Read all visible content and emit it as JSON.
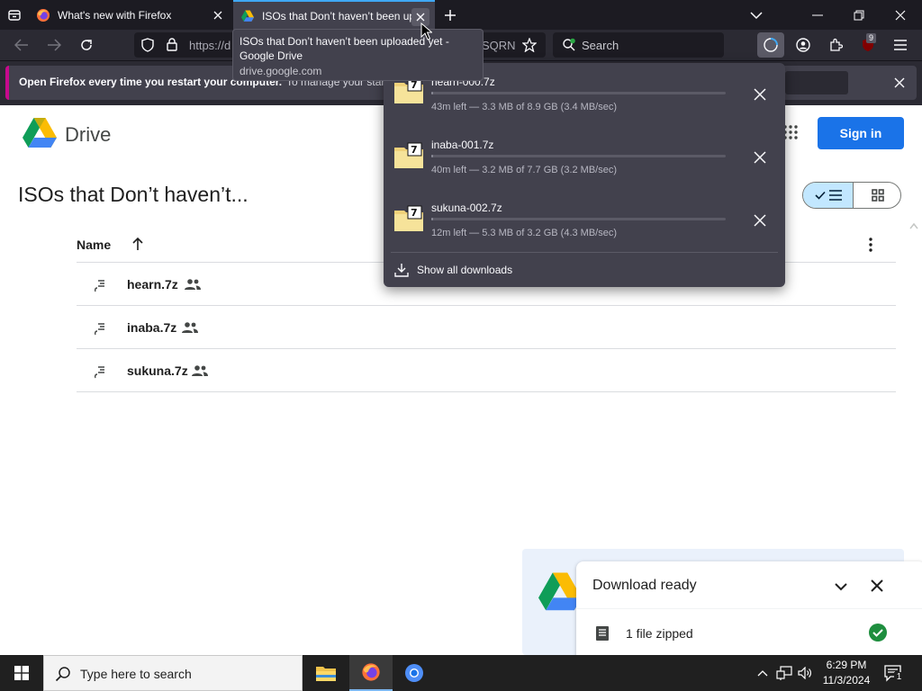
{
  "browser": {
    "tabs": [
      {
        "title": "What's new with Firefox",
        "active": false
      },
      {
        "title": "ISOs that Don’t haven’t been uploaded yet - Google Drive",
        "active": true
      }
    ],
    "url_left": "https://d",
    "url_right": "SQRN",
    "search_placeholder": "Search",
    "extension_badge": "9",
    "tooltip": {
      "title": "ISOs that Don’t haven’t been uploaded yet - Google Drive",
      "domain": "drive.google.com"
    }
  },
  "notification": {
    "bold_text": "Open Firefox every time you restart your computer.",
    "rest_text": "To manage your start"
  },
  "downloads": {
    "items": [
      {
        "name": "hearn-000.7z",
        "status": "43m left — 3.3 MB of 8.9 GB (3.4 MB/sec)",
        "progress": 0.0004
      },
      {
        "name": "inaba-001.7z",
        "status": "40m left — 3.2 MB of 7.7 GB (3.2 MB/sec)",
        "progress": 0.0004
      },
      {
        "name": "sukuna-002.7z",
        "status": "12m left — 5.3 MB of 3.2 GB (4.3 MB/sec)",
        "progress": 0.0017
      }
    ],
    "show_all": "Show all downloads"
  },
  "drive": {
    "brand": "Drive",
    "sign_in": "Sign in",
    "folder_title": "ISOs that Don’t haven’t...",
    "column_name": "Name",
    "files": [
      {
        "name": "hearn.7z",
        "shared": true
      },
      {
        "name": "inaba.7z",
        "shared": true
      },
      {
        "name": "sukuna.7z",
        "shared": true
      }
    ],
    "toast": {
      "title": "Download ready",
      "item": "1 file zipped"
    }
  },
  "colors": {
    "firefox_dark": "#1c1b22",
    "toolbar": "#2b2a33",
    "panel": "#42414d",
    "accent_blue": "#3fa8f4",
    "drive_blue": "#1a73e8",
    "success_green": "#1e8e3e"
  },
  "taskbar": {
    "search_placeholder": "Type here to search",
    "time": "6:29 PM",
    "date": "11/3/2024",
    "notification_count": "1"
  }
}
